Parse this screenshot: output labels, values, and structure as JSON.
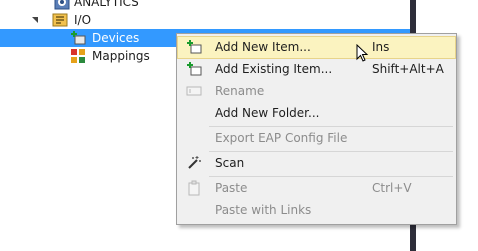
{
  "tree": {
    "analytics": "ANALYTICS",
    "io": "I/O",
    "devices": "Devices",
    "mappings": "Mappings"
  },
  "context_menu": {
    "items": [
      {
        "label": "Add New Item...",
        "shortcut": "Ins",
        "enabled": true,
        "highlighted": true
      },
      {
        "label": "Add Existing Item...",
        "shortcut": "Shift+Alt+A",
        "enabled": true
      },
      {
        "label": "Rename",
        "shortcut": "",
        "enabled": false
      },
      {
        "label": "Add New Folder...",
        "shortcut": "",
        "enabled": true
      },
      {
        "label": "Export EAP Config File",
        "shortcut": "",
        "enabled": false
      },
      {
        "label": "Scan",
        "shortcut": "",
        "enabled": true
      },
      {
        "label": "Paste",
        "shortcut": "Ctrl+V",
        "enabled": false
      },
      {
        "label": "Paste with Links",
        "shortcut": "",
        "enabled": false
      }
    ]
  },
  "colors": {
    "selection": "#3399ff",
    "menu_background": "#f0f0f0",
    "highlight": "#fbf3c0",
    "divider": "#2e2e3a"
  }
}
